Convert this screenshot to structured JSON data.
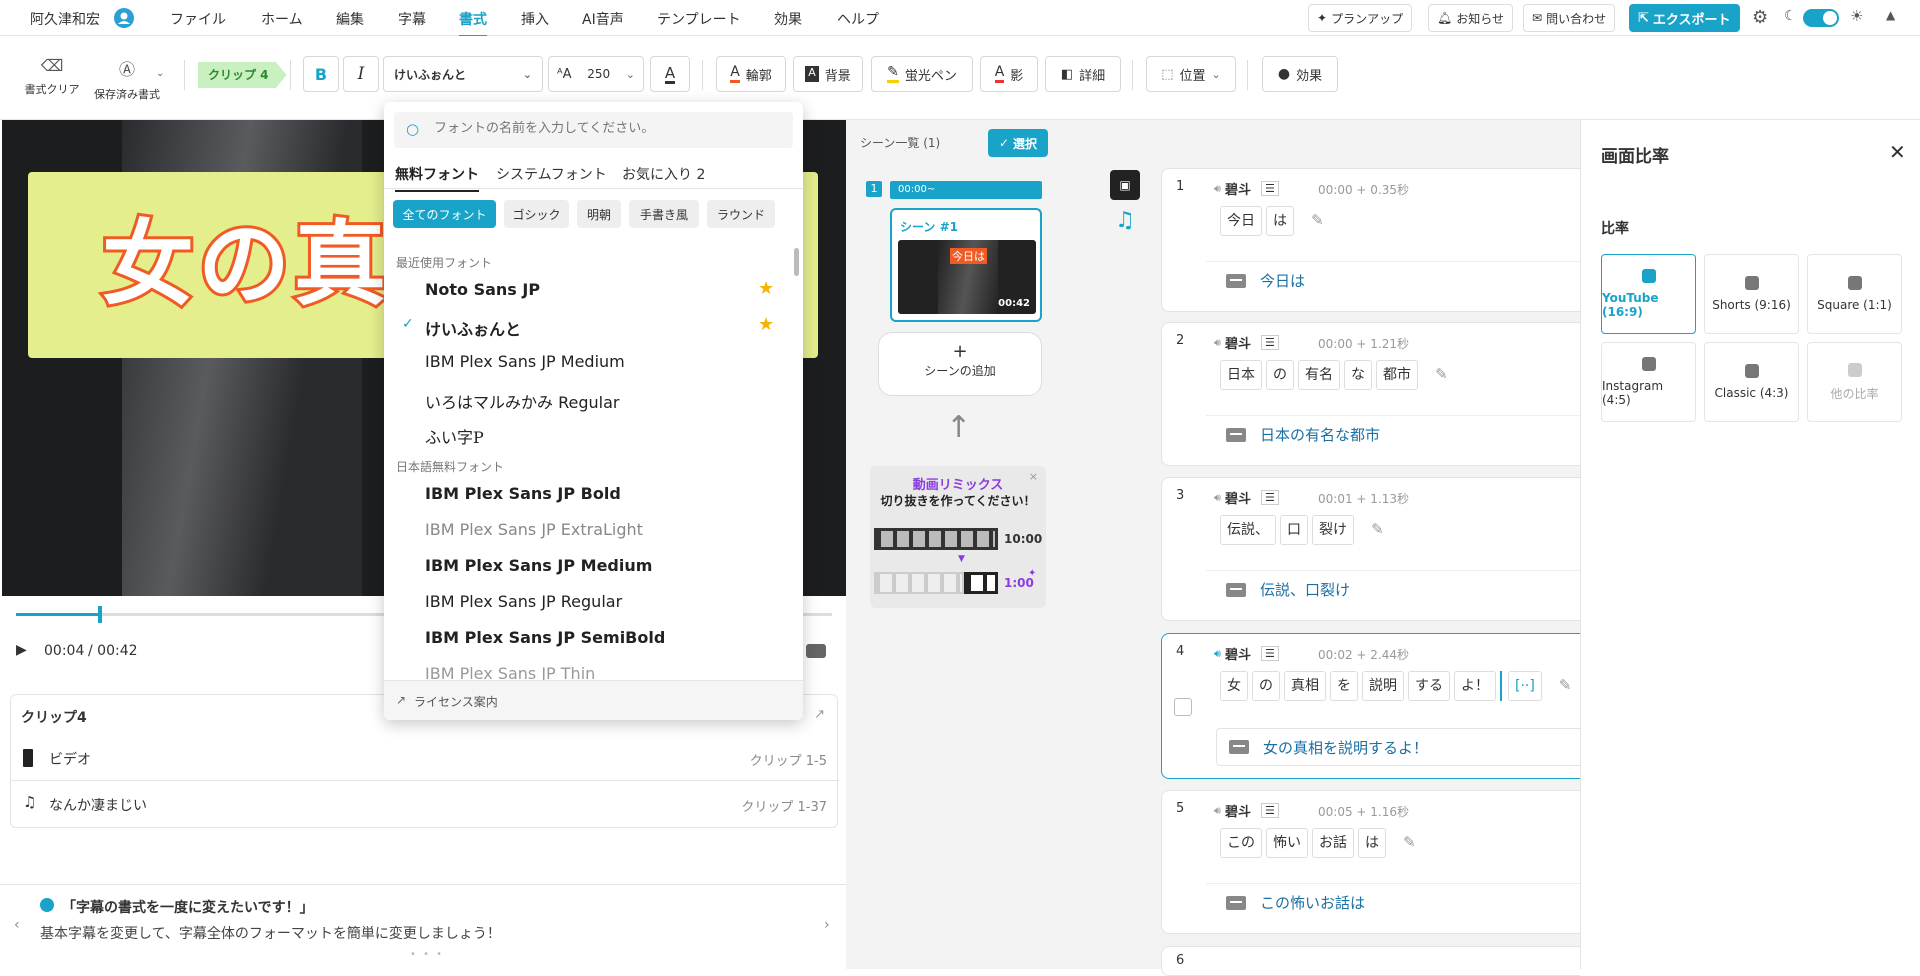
{
  "menubar": {
    "user_name": "阿久津和宏",
    "menus": [
      "ファイル",
      "ホーム",
      "編集",
      "字幕",
      "書式",
      "挿入",
      "AI音声",
      "テンプレート",
      "効果",
      "ヘルプ"
    ],
    "active_menu": "書式",
    "plan_up": "プランアップ",
    "notice": "お知らせ",
    "contact": "問い合わせ",
    "export": "エクスポート"
  },
  "toolbar": {
    "clear_format": "書式クリア",
    "saved_format": "保存済み書式",
    "clip_label": "クリップ 4",
    "bold": "B",
    "italic": "I",
    "font_name": "けいふぉんと",
    "font_size": "250",
    "outline": "輪郭",
    "background": "背景",
    "highlighter": "蛍光ペン",
    "shadow": "影",
    "details": "詳細",
    "position": "位置",
    "effects": "効果"
  },
  "preview": {
    "title_text": "女の真相",
    "time_current": "00:04",
    "time_total": "/ 00:42",
    "progress": 0.1
  },
  "clip_panel": {
    "title": "クリップ4",
    "tracks": [
      {
        "name": "ビデオ",
        "range": "クリップ 1-5"
      },
      {
        "name": "なんか凄まじい",
        "range": "クリップ 1-37"
      }
    ]
  },
  "tip": {
    "title": "「字幕の書式を一度に変えたいです！」",
    "body": "基本字幕を変更して、字幕全体のフォーマットを簡単に変更しましょう！"
  },
  "font_dropdown": {
    "search_placeholder": "フォントの名前を入力してください。",
    "tabs": [
      "無料フォント",
      "システムフォント",
      "お気に入り 2"
    ],
    "chips": [
      "全てのフォント",
      "ゴシック",
      "明朝",
      "手書き風",
      "ラウンド"
    ],
    "recent_header": "最近使用フォント",
    "recent": [
      "Noto Sans JP",
      "けいふぉんと",
      "IBM Plex Sans JP Medium",
      "いろはマルみかみ Regular",
      "ふい字P"
    ],
    "free_header": "日本語無料フォント",
    "free": [
      "IBM Plex Sans JP Bold",
      "IBM Plex Sans JP ExtraLight",
      "IBM Plex Sans JP Medium",
      "IBM Plex Sans JP Regular",
      "IBM Plex Sans JP SemiBold",
      "IBM Plex Sans JP Thin"
    ],
    "license": "ライセンス案内"
  },
  "scenes": {
    "header": "シーン一覧 (1)",
    "select_btn": "選択",
    "scene_index": "1",
    "scene_time": "00:00~",
    "scene_name": "シーン #1",
    "thumb_caption": "今日は",
    "thumb_duration": "00:42",
    "add_scene": "シーンの追加",
    "remix_title": "動画リミックス",
    "remix_sub": "切り抜きを作ってください！",
    "remix_long": "10:00",
    "remix_short": "1:00"
  },
  "subtitles": [
    {
      "num": "1",
      "speaker": "碧斗",
      "time": "00:00 + 0.35秒",
      "tokens": [
        "今日",
        "は"
      ],
      "text": "今日は"
    },
    {
      "num": "2",
      "speaker": "碧斗",
      "time": "00:00 + 1.21秒",
      "tokens": [
        "日本",
        "の",
        "有名",
        "な",
        "都市"
      ],
      "text": "日本の有名な都市"
    },
    {
      "num": "3",
      "speaker": "碧斗",
      "time": "00:01 + 1.13秒",
      "tokens": [
        "伝説、",
        "口",
        "裂け"
      ],
      "text": "伝説、口裂け"
    },
    {
      "num": "4",
      "speaker": "碧斗",
      "time": "00:02 + 2.44秒",
      "tokens": [
        "女",
        "の",
        "真相",
        "を",
        "説明",
        "する",
        "よ！"
      ],
      "extra": "[··]",
      "text": "女の真相を説明するよ！"
    },
    {
      "num": "5",
      "speaker": "碧斗",
      "time": "00:05 + 1.16秒",
      "tokens": [
        "この",
        "怖い",
        "お話",
        "は"
      ],
      "text": "この怖いお話は"
    },
    {
      "num": "6",
      "speaker": "",
      "time": "",
      "tokens": [],
      "text": ""
    }
  ],
  "ratio_panel": {
    "title": "画面比率",
    "section": "比率",
    "options": [
      "YouTube (16:9)",
      "Shorts (9:16)",
      "Square (1:1)",
      "Instagram (4:5)",
      "Classic (4:3)",
      "他の比率"
    ],
    "selected": "YouTube (16:9)"
  },
  "colors": {
    "accent": "#1aa3c8",
    "clip_green": "#c8f0c0",
    "title_orange": "#f05a24",
    "banner": "#e4ee8c"
  }
}
